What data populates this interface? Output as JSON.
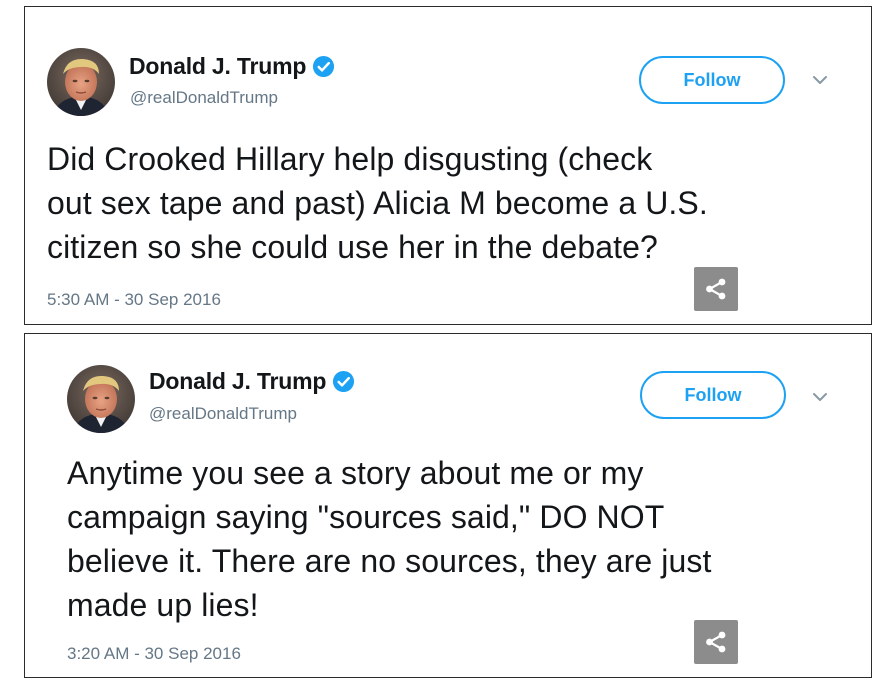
{
  "colors": {
    "accent": "#1da1f2",
    "muted_text": "#657786",
    "body_text": "#14171a",
    "share_bg": "#8c8c8c",
    "border": "#2b2b2b"
  },
  "tweets": [
    {
      "author": {
        "display_name": "Donald J. Trump",
        "handle": "@realDonaldTrump",
        "verified": true,
        "avatar_icon": "profile-photo"
      },
      "follow_label": "Follow",
      "menu_icon": "chevron-down-icon",
      "text": "Did Crooked Hillary help disgusting (check\nout sex tape and past) Alicia M become a U.S.\ncitizen so she could use her in the debate?",
      "timestamp": "5:30 AM - 30 Sep 2016",
      "share_icon": "share-icon"
    },
    {
      "author": {
        "display_name": "Donald J. Trump",
        "handle": "@realDonaldTrump",
        "verified": true,
        "avatar_icon": "profile-photo"
      },
      "follow_label": "Follow",
      "menu_icon": "chevron-down-icon",
      "text": "Anytime you see a story about me or my\ncampaign saying \"sources said,\" DO NOT\nbelieve it. There are no sources, they are just\nmade up lies!",
      "timestamp": "3:20 AM - 30 Sep 2016",
      "share_icon": "share-icon"
    }
  ]
}
